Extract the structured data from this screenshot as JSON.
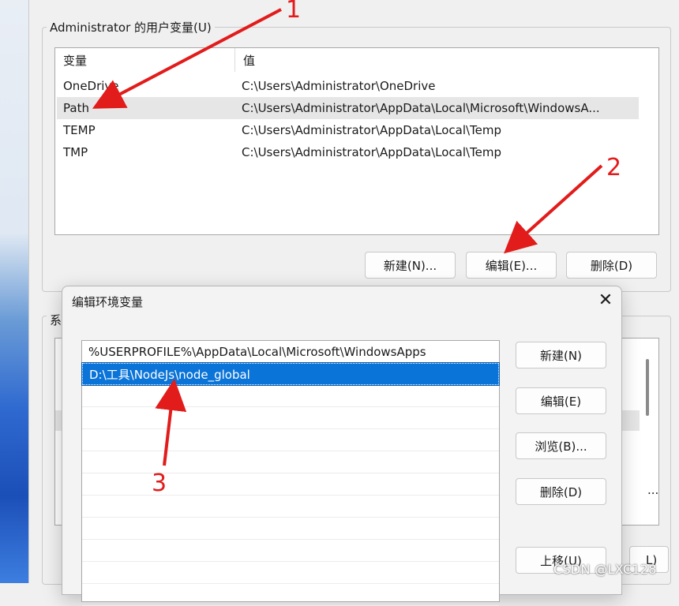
{
  "env_dialog": {
    "user_group_label": "Administrator 的用户变量(U)",
    "user_vars": {
      "headers": [
        "变量",
        "值"
      ],
      "rows": [
        {
          "name": "OneDrive",
          "value": "C:\\Users\\Administrator\\OneDrive"
        },
        {
          "name": "Path",
          "value": "C:\\Users\\Administrator\\AppData\\Local\\Microsoft\\WindowsA..."
        },
        {
          "name": "TEMP",
          "value": "C:\\Users\\Administrator\\AppData\\Local\\Temp"
        },
        {
          "name": "TMP",
          "value": "C:\\Users\\Administrator\\AppData\\Local\\Temp"
        }
      ],
      "selected_row": 1
    },
    "user_buttons": {
      "new": "新建(N)...",
      "edit": "编辑(E)...",
      "delete": "删除(D)"
    },
    "sys_group_label": "系",
    "sys_ellipsis": "...",
    "sys_partial_button": "L)"
  },
  "edit_dialog": {
    "title": "编辑环境变量",
    "close_glyph": "✕",
    "entries": [
      "%USERPROFILE%\\AppData\\Local\\Microsoft\\WindowsApps",
      "D:\\工具\\NodeJs\\node_global"
    ],
    "selected_entry": 1,
    "buttons": {
      "new": "新建(N)",
      "edit": "编辑(E)",
      "browse": "浏览(B)...",
      "delete": "删除(D)",
      "move_up": "上移(U)"
    }
  },
  "annotations": {
    "labels": [
      "1",
      "2",
      "3"
    ],
    "color": "#e21b1b"
  },
  "watermark": "CSDN @LXC128"
}
